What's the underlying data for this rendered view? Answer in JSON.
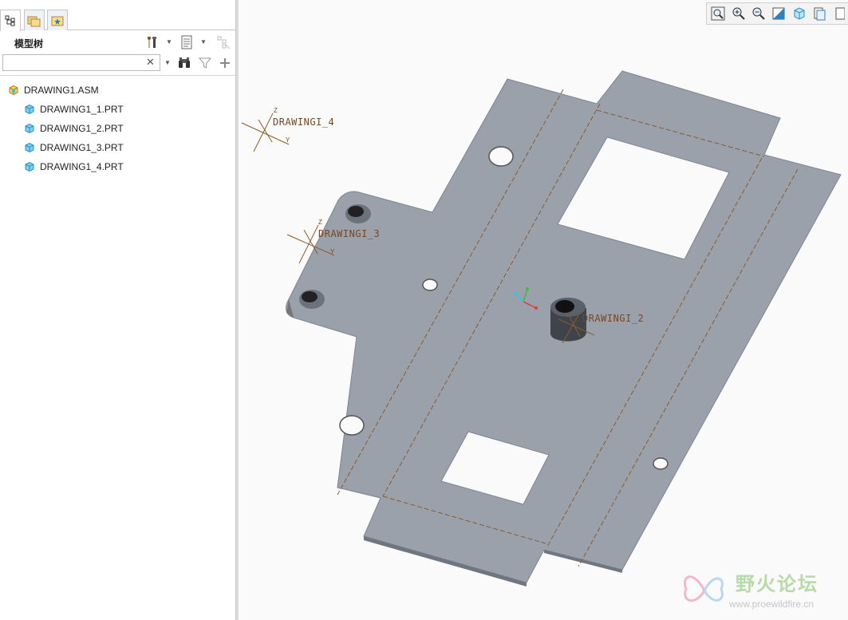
{
  "model_tree": {
    "title": "模型树",
    "search": {
      "value": "",
      "placeholder": ""
    },
    "root": {
      "label": "DRAWING1.ASM",
      "icon": "assembly-icon"
    },
    "children": [
      {
        "label": "DRAWING1_1.PRT",
        "icon": "part-icon"
      },
      {
        "label": "DRAWING1_2.PRT",
        "icon": "part-icon"
      },
      {
        "label": "DRAWING1_3.PRT",
        "icon": "part-icon"
      },
      {
        "label": "DRAWING1_4.PRT",
        "icon": "part-icon"
      }
    ]
  },
  "viewport": {
    "csys_labels": {
      "d4": "DRAWINGI_4",
      "d3": "DRAWINGI_3",
      "d2": "DRAWINGI_2"
    },
    "axis_z": "Z",
    "axis_y": "Y",
    "axis_x": "X"
  },
  "watermark": {
    "title": "野火论坛",
    "url": "www.proewildfire.cn"
  },
  "colors": {
    "sheet": "#9aa1ab",
    "sheet_edge": "#7e8590",
    "datum": "#8b5a2b",
    "background": "#fafafa"
  }
}
